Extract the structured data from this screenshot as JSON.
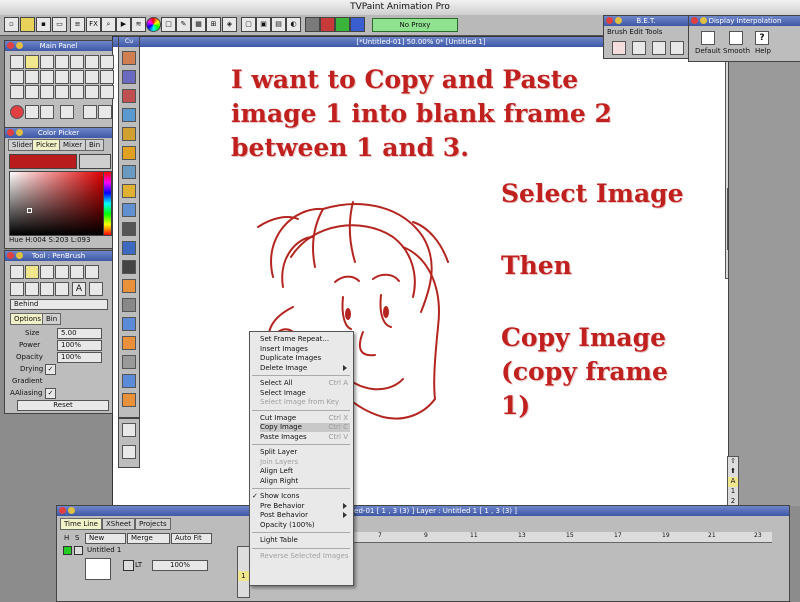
{
  "app": {
    "title": "TVPaint Animation Pro"
  },
  "toolbar": {
    "fx_label": "FX",
    "proxy_label": "No Proxy"
  },
  "canvas": {
    "title": "[*Untitled-01]  50.00%  0*  [Untitled 1]"
  },
  "annotations": {
    "line1": "I want to Copy and Paste",
    "line2": "image 1 into blank frame 2",
    "line3": "between 1 and 3.",
    "select": "Select Image",
    "then": "Then",
    "copy1": "Copy Image",
    "copy2": "(copy frame",
    "copy3": "1)"
  },
  "main_panel": {
    "title": "Main Panel"
  },
  "color_picker": {
    "title": "Color Picker",
    "tabs": [
      "Slider",
      "Picker",
      "Mixer",
      "Bin"
    ],
    "hsl": "Hue H:004 S:203 L:093",
    "main_color": "#b81c1c",
    "secondary_color": "#cfcfcf"
  },
  "tool_panel": {
    "title": "Tool : PenBrush",
    "mode": "Behind",
    "tabs": [
      "Options",
      "Bin"
    ],
    "size_label": "Size",
    "size_value": "5.00",
    "power_label": "Power",
    "power_value": "100%",
    "opacity_label": "Opacity",
    "opacity_value": "100%",
    "drying_label": "Drying",
    "gradient_label": "Gradient",
    "aaliasing_label": "AAliasing",
    "reset_label": "Reset"
  },
  "side_strip": {
    "title": "Cu"
  },
  "bet_panel": {
    "title": "B.E.T.",
    "subtitle": "Brush Edit Tools"
  },
  "interp_panel": {
    "title": "Display Interpolation",
    "buttons": [
      "Default",
      "Smooth",
      "Help"
    ]
  },
  "context_menu": {
    "items": [
      {
        "label": "Set Frame Repeat...",
        "shortcut": "",
        "state": "normal",
        "sub": false
      },
      {
        "label": "Insert Images",
        "shortcut": "",
        "state": "normal",
        "sub": false
      },
      {
        "label": "Duplicate Images",
        "shortcut": "",
        "state": "normal",
        "sub": false
      },
      {
        "label": "Delete Image",
        "shortcut": "",
        "state": "normal",
        "sub": true
      },
      {
        "sep": true
      },
      {
        "label": "Select All",
        "shortcut": "Ctrl A",
        "state": "normal",
        "sub": false
      },
      {
        "label": "Select Image",
        "shortcut": "",
        "state": "normal",
        "sub": false
      },
      {
        "label": "Select Image from Key",
        "shortcut": "",
        "state": "disabled",
        "sub": false
      },
      {
        "sep": true
      },
      {
        "label": "Cut Image",
        "shortcut": "Ctrl X",
        "state": "normal",
        "sub": false
      },
      {
        "label": "Copy Image",
        "shortcut": "Ctrl C",
        "state": "highlight",
        "sub": false
      },
      {
        "label": "Paste Images",
        "shortcut": "Ctrl V",
        "state": "normal",
        "sub": false
      },
      {
        "sep": true
      },
      {
        "label": "Split Layer",
        "shortcut": "",
        "state": "normal",
        "sub": false
      },
      {
        "label": "Join Layers",
        "shortcut": "",
        "state": "disabled",
        "sub": false
      },
      {
        "label": "Align Left",
        "shortcut": "",
        "state": "normal",
        "sub": false
      },
      {
        "label": "Align Right",
        "shortcut": "",
        "state": "normal",
        "sub": false
      },
      {
        "sep": true
      },
      {
        "label": "Show Icons",
        "shortcut": "",
        "state": "checked",
        "sub": false
      },
      {
        "label": "Pre Behavior",
        "shortcut": "",
        "state": "normal",
        "sub": true
      },
      {
        "label": "Post Behavior",
        "shortcut": "",
        "state": "normal",
        "sub": true
      },
      {
        "label": "Opacity (100%)",
        "shortcut": "",
        "state": "normal",
        "sub": false
      },
      {
        "sep": true
      },
      {
        "label": "Light Table",
        "shortcut": "",
        "state": "normal",
        "sub": false
      },
      {
        "sep": true
      },
      {
        "label": "Reverse Selected Images",
        "shortcut": "",
        "state": "disabled",
        "sub": false
      }
    ]
  },
  "timeline": {
    "title": "[*Untitled-01 [ 1 , 3  (3) ]      Layer : Untitled 1 [ 1 , 3  (3) ]",
    "tabs": [
      "Time Line",
      "XSheet",
      "Projects"
    ],
    "h": "H",
    "s": "S",
    "new_label": "New",
    "merge_label": "Merge",
    "autofit_label": "Auto Fit",
    "z_label": "Z",
    "layer_name": "Untitled 1",
    "opacity": "100%",
    "lt": "LT",
    "frame_numbers": [
      "1",
      "3",
      "5",
      "7",
      "9",
      "11",
      "13",
      "15",
      "17",
      "19",
      "21",
      "23"
    ],
    "current_frame": "1"
  }
}
